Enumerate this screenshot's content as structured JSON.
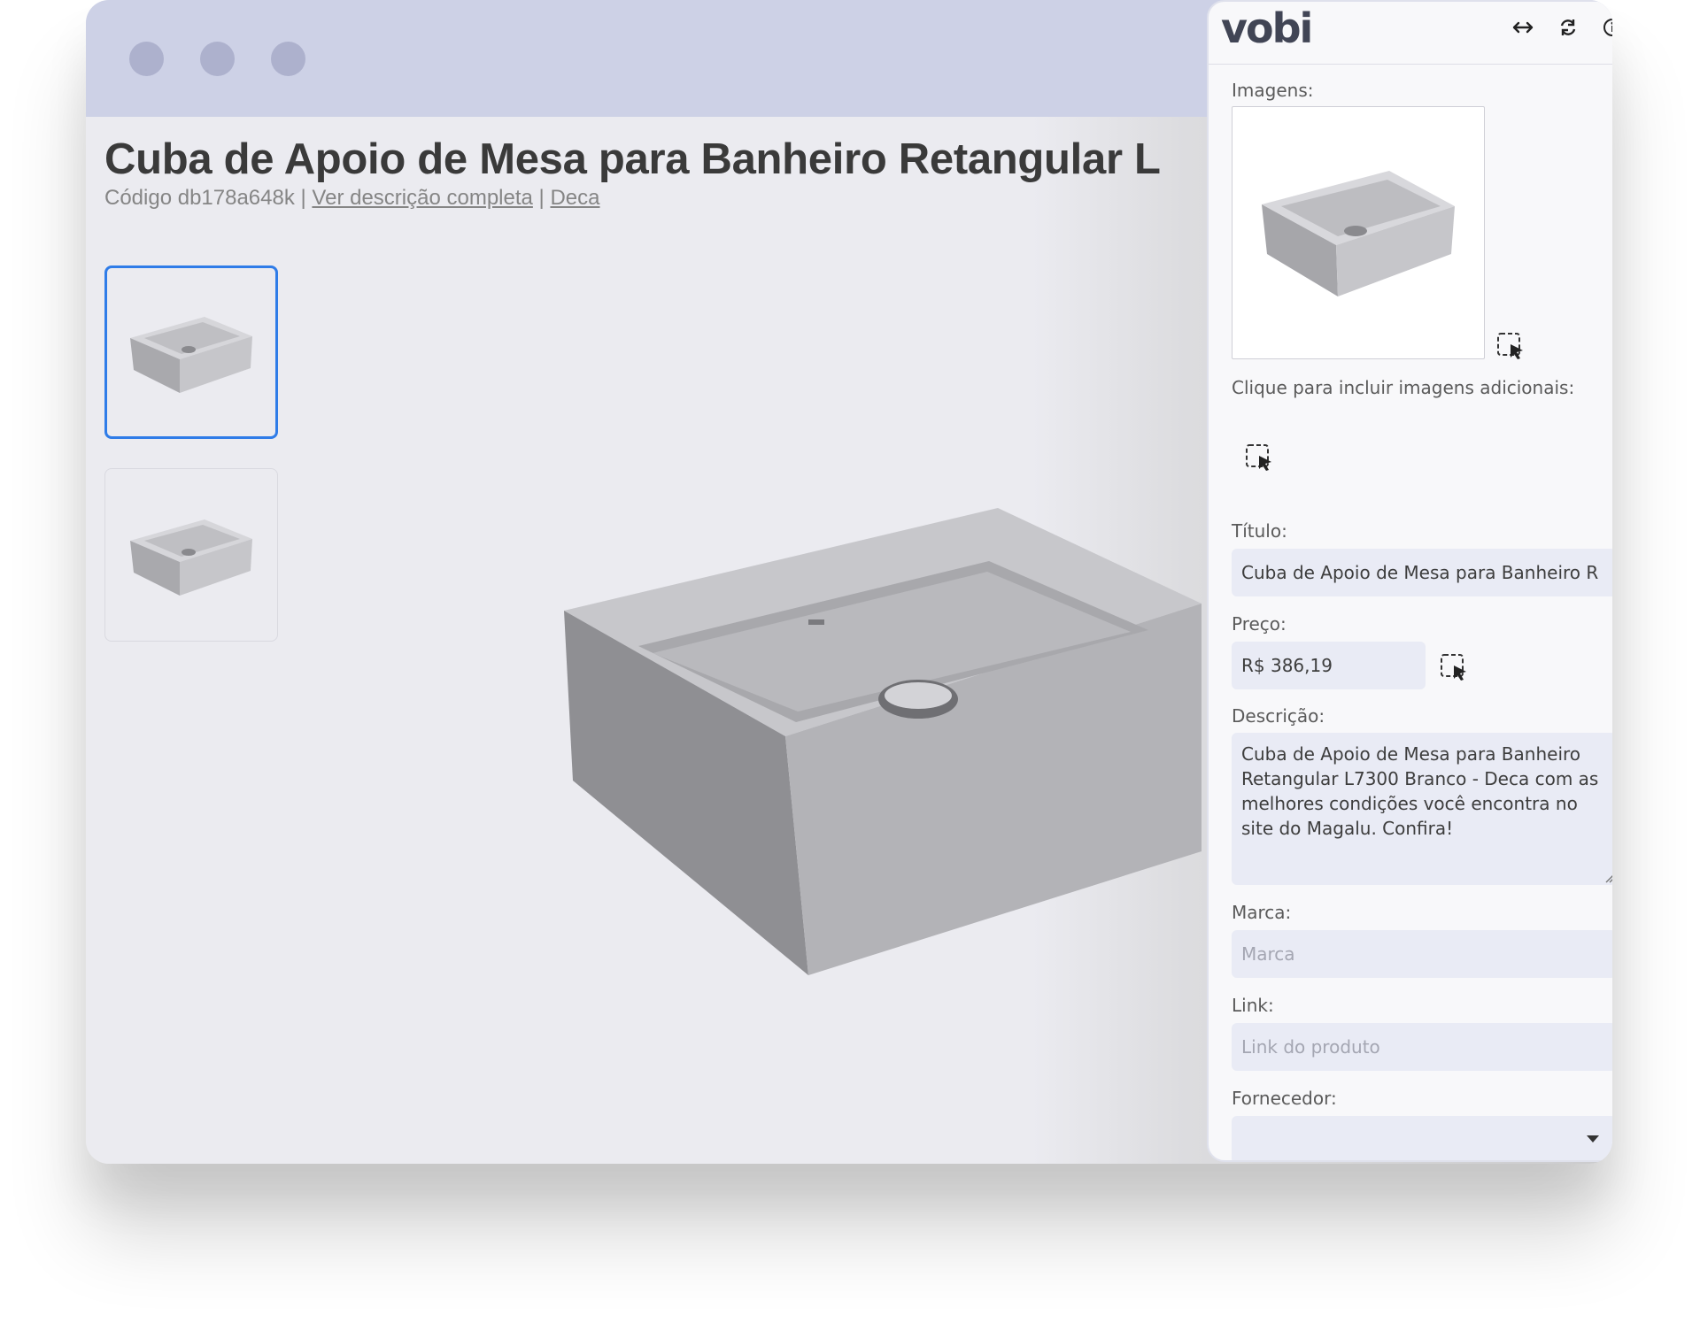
{
  "product": {
    "title": "Cuba de Apoio de Mesa para Banheiro Retangular L",
    "code_prefix": "Código db178a648k | ",
    "description_link": "Ver descrição completa",
    "separator": " | ",
    "brand_link": "Deca"
  },
  "panel": {
    "logo": "vobi",
    "header_icons": [
      "expand-horizontal-icon",
      "refresh-icon",
      "info-icon",
      "close-icon"
    ],
    "images_label": "Imagens:",
    "extra_images_label": "Clique para incluir imagens adicionais:",
    "title_label": "Título:",
    "title_value": "Cuba de Apoio de Mesa para Banheiro R",
    "price_label": "Preço:",
    "price_value": "R$ 386,19",
    "description_label": "Descrição:",
    "description_value": "Cuba de Apoio de Mesa para Banheiro Retangular L7300 Branco - Deca com as melhores condições você encontra no site do Magalu. Confira!",
    "brand_label": "Marca:",
    "brand_placeholder": "Marca",
    "link_label": "Link:",
    "link_placeholder": "Link do produto",
    "supplier_label": "Fornecedor:",
    "supplier_value": ""
  },
  "colors": {
    "accent": "#2f7ce8",
    "titlebar": "#cdd1e6",
    "field_bg": "#e9ebf5"
  }
}
